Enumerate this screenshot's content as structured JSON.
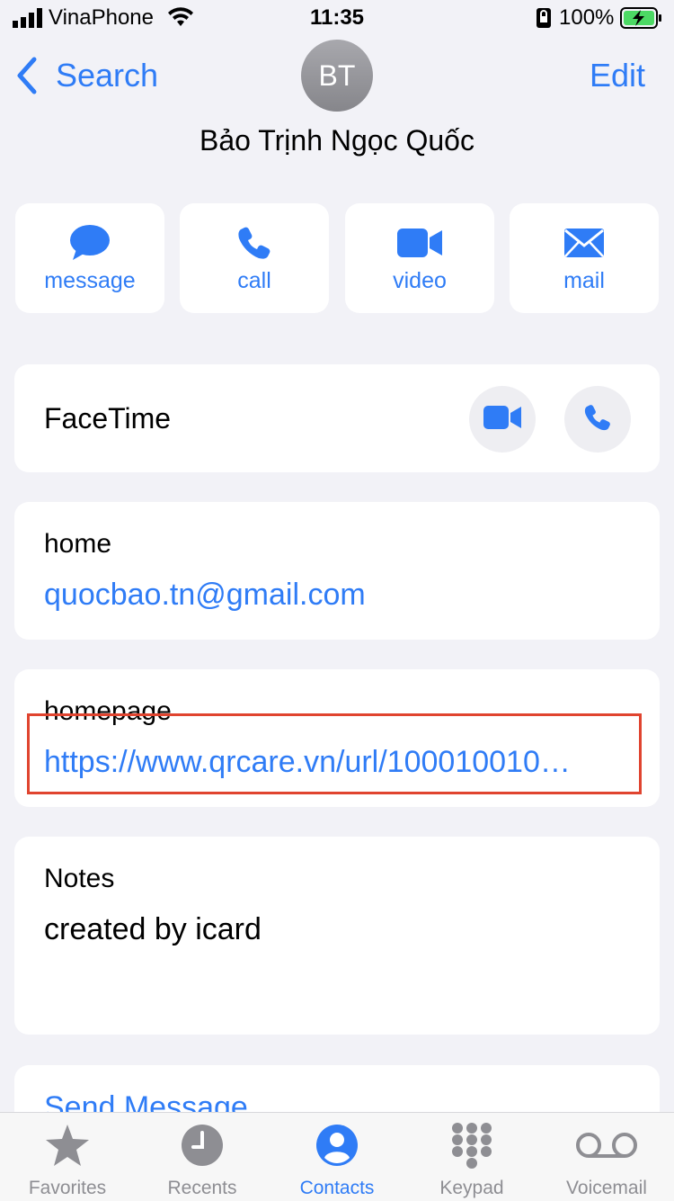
{
  "status": {
    "carrier": "VinaPhone",
    "time": "11:35",
    "battery": "100%"
  },
  "nav": {
    "back_label": "Search",
    "edit_label": "Edit"
  },
  "contact": {
    "initials": "BT",
    "name": "Bảo Trịnh Ngọc Quốc"
  },
  "actions": [
    {
      "label": "message",
      "icon": "message-bubble-icon"
    },
    {
      "label": "call",
      "icon": "phone-icon"
    },
    {
      "label": "video",
      "icon": "video-camera-icon"
    },
    {
      "label": "mail",
      "icon": "envelope-icon"
    }
  ],
  "facetime": {
    "label": "FaceTime"
  },
  "email": {
    "label": "home",
    "value": "quocbao.tn@gmail.com"
  },
  "homepage": {
    "label": "homepage",
    "value": "https://www.qrcare.vn/url/100010010…"
  },
  "notes": {
    "label": "Notes",
    "value": "created by icard"
  },
  "send_message": {
    "label": "Send Message"
  },
  "tabs": [
    {
      "label": "Favorites",
      "icon": "star-icon"
    },
    {
      "label": "Recents",
      "icon": "clock-icon"
    },
    {
      "label": "Contacts",
      "icon": "person-circle-icon",
      "active": true
    },
    {
      "label": "Keypad",
      "icon": "keypad-icon"
    },
    {
      "label": "Voicemail",
      "icon": "voicemail-icon"
    }
  ],
  "colors": {
    "accent": "#2f7cf6",
    "background": "#f2f2f7",
    "highlight": "#e0442f"
  }
}
